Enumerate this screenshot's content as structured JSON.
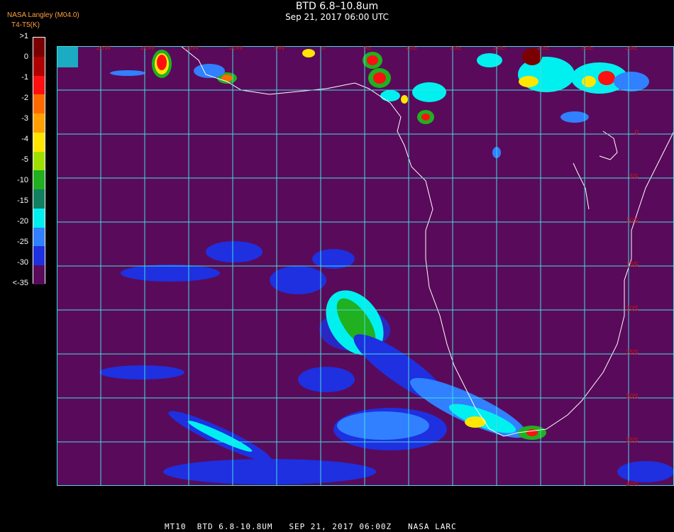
{
  "header": {
    "title": "BTD 6.8–10.8um",
    "subtitle": "Sep 21, 2017 06:00 UTC",
    "provider": "NASA Langley (M04.0)",
    "unit": "T4-T5(K)",
    "footer": "MT10  BTD 6.8-10.8UM   SEP 21, 2017 06:00Z   NASA LARC"
  },
  "legend": {
    "labels": [
      ">1",
      "0",
      "-1",
      "-2",
      "-3",
      "-4",
      "-5",
      "-10",
      "-15",
      "-20",
      "-25",
      "-30",
      "<-35"
    ],
    "colors": [
      "#7a0000",
      "#b00000",
      "#ff1010",
      "#ff6a00",
      "#ffa000",
      "#ffe600",
      "#a0e000",
      "#20b020",
      "#108060",
      "#00f0f0",
      "#3080ff",
      "#1e30e0",
      "#5a0a5a"
    ]
  },
  "map": {
    "background_color": "#5a0a5a",
    "grid_color": "#40e0e0",
    "coast_color": "#ffffff",
    "label_color": "#c81414",
    "lon_labels": [
      "25W",
      "20W",
      "15W",
      "10W",
      "5W",
      "0",
      "5E",
      "10E",
      "15E",
      "20E",
      "25E",
      "30E",
      "35E"
    ],
    "lat_labels": [
      "0",
      "5S",
      "10S",
      "15S",
      "20S",
      "25S",
      "30S",
      "35S",
      "40S"
    ]
  }
}
